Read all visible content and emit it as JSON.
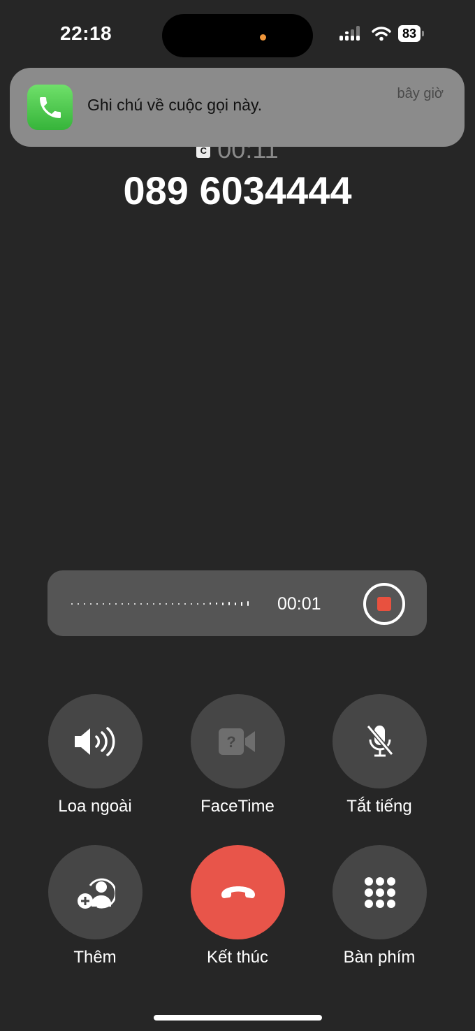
{
  "status_bar": {
    "time": "22:18",
    "battery": "83",
    "icons": [
      "signal-icon",
      "wifi-icon",
      "battery-icon"
    ]
  },
  "notification": {
    "app_icon": "phone-icon",
    "message": "Ghi chú về cuộc gọi này.",
    "time": "bây giờ"
  },
  "call": {
    "recording_badge": "C",
    "duration": "00:11",
    "number": "089 6034444"
  },
  "recording": {
    "elapsed": "00:01",
    "stop_color": "#e8513f"
  },
  "buttons": [
    {
      "label": "Loa ngoài",
      "icon": "speaker-icon"
    },
    {
      "label": "FaceTime",
      "icon": "facetime-icon"
    },
    {
      "label": "Tắt tiếng",
      "icon": "mute-icon"
    },
    {
      "label": "Thêm",
      "icon": "add-call-icon"
    },
    {
      "label": "Kết thúc",
      "icon": "end-call-icon",
      "color": "#e8554a"
    },
    {
      "label": "Bàn phím",
      "icon": "keypad-icon"
    }
  ]
}
